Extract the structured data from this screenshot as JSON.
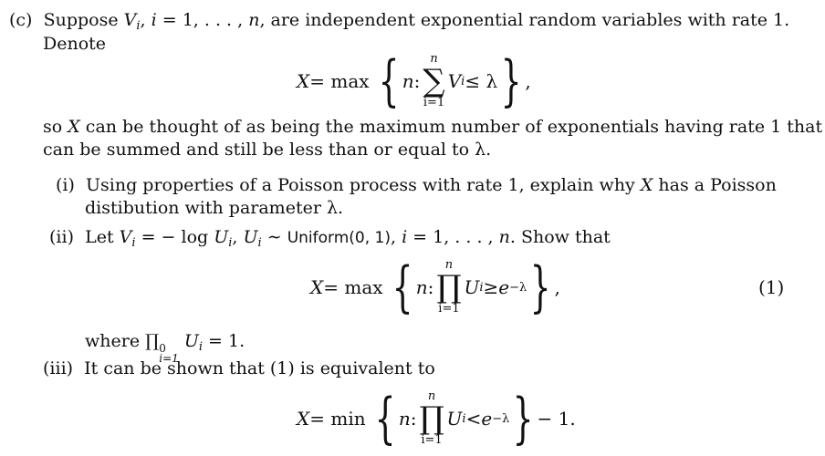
{
  "problem": {
    "part_label": "(c)",
    "intro_line1": {
      "t1": "Suppose ",
      "V": "V",
      "sub": "i",
      "t2": ", ",
      "i": "i",
      "t3": " = 1, . . . , ",
      "n": "n",
      "t4": ", are independent exponential random variables with rate 1."
    },
    "intro_line2": "Denote",
    "eq_sum": {
      "lhs": "X",
      "eq": " = max",
      "n": "n",
      "colon": " : ",
      "op": "∑",
      "upper": "n",
      "lower": "i=1",
      "body_var": "V",
      "body_sub": "i",
      "rel": " ≤ λ",
      "trail": ","
    },
    "so_line1": {
      "t1": "so ",
      "X": "X",
      "t2": " can be thought of as being the maximum number of exponentials having rate 1 that"
    },
    "so_line2": "can be summed and still be less than or equal to λ.",
    "sub_i": {
      "label": "(i)",
      "line1_a": "Using properties of a Poisson process with rate 1, explain why ",
      "line1_X": "X",
      "line1_b": " has a Poisson",
      "line2": "distibution with parameter λ."
    },
    "sub_ii": {
      "label": "(ii)",
      "t1": "Let ",
      "V": "V",
      "Vsub": "i",
      "t2": " = − log ",
      "U1": "U",
      "U1sub": "i",
      "t3": ", ",
      "U2": "U",
      "U2sub": "i",
      "t4": " ∼ ",
      "dist": "Uniform(0, 1)",
      "t5": ", ",
      "i": "i",
      "t6": " = 1, . . . , ",
      "n": "n",
      "t7": ". Show that"
    },
    "eq1": {
      "lhs": "X",
      "eq": " = max",
      "n": "n",
      "colon": " : ",
      "op": "∏",
      "upper": "n",
      "lower": "i=1",
      "body_var": "U",
      "body_sub": "i",
      "rel": " ≥ ",
      "e": "e",
      "exp": "−λ",
      "trail": ",",
      "number": "(1)"
    },
    "where_line": {
      "t1": "where ",
      "op": "∏",
      "sup": "0",
      "sub": "i=1",
      "U": "U",
      "Usub": "i",
      "t2": " = 1."
    },
    "sub_iii": {
      "label": "(iii)",
      "text": "It can be shown that (1) is equivalent to"
    },
    "eq_min": {
      "lhs": "X",
      "eq": " = min",
      "n": "n",
      "colon": " : ",
      "op": "∏",
      "upper": "n",
      "lower": "i=1",
      "body_var": "U",
      "body_sub": "i",
      "rel": " < ",
      "e": "e",
      "exp": "−λ",
      "trail": " − 1."
    }
  }
}
